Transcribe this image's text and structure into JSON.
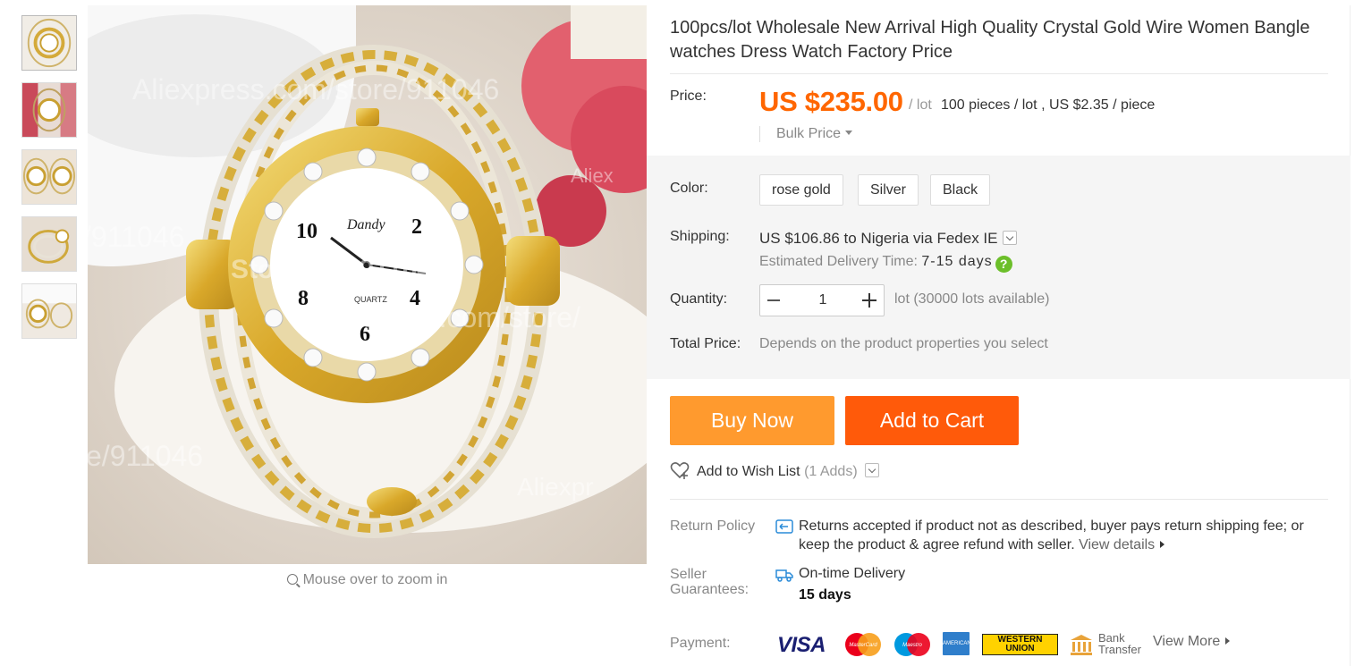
{
  "gallery": {
    "thumbnails": [
      "thumbnail-1",
      "thumbnail-2",
      "thumbnail-3",
      "thumbnail-4",
      "thumbnail-5"
    ],
    "zoom_hint": "Mouse over to zoom in",
    "watermarks": [
      "Aliexpress.com/store/911046",
      "/911046",
      "Store No: 911046",
      "Aliexpress.com/store/",
      "e/911046",
      "Aliexpr",
      "Aliex"
    ],
    "watch_dial": {
      "brand": "Dandy",
      "movement": "QUARTZ",
      "numerals": [
        "10",
        "2",
        "8",
        "4",
        "6"
      ]
    }
  },
  "product": {
    "title": "100pcs/lot Wholesale New Arrival High Quality Crystal Gold Wire Women Bangle watches Dress Watch Factory Price"
  },
  "price": {
    "label": "Price:",
    "amount": "US $235.00",
    "unit": "/ lot",
    "pieces": "100 pieces / lot , US $2.35 / piece",
    "bulk_label": "Bulk Price"
  },
  "color": {
    "label": "Color:",
    "options": [
      "rose gold",
      "Silver",
      "Black"
    ]
  },
  "shipping": {
    "label": "Shipping:",
    "main": "US $106.86 to Nigeria via Fedex IE",
    "delivery_label": "Estimated Delivery Time:",
    "delivery_days": "7-15 days",
    "help": "?"
  },
  "quantity": {
    "label": "Quantity:",
    "value": "1",
    "available": "lot (30000 lots available)"
  },
  "total": {
    "label": "Total Price:",
    "text": "Depends on the product properties you select"
  },
  "actions": {
    "buy_now": "Buy Now",
    "add_to_cart": "Add to Cart",
    "wish_list": "Add to Wish List",
    "wish_count": "(1 Adds)"
  },
  "return_policy": {
    "label": "Return Policy",
    "text": "Returns accepted if product not as described, buyer pays return shipping fee; or keep the product & agree refund with seller.",
    "link": "View details"
  },
  "seller_guarantees": {
    "label": "Seller Guarantees:",
    "delivery": "On-time Delivery",
    "days": "15 days"
  },
  "payment": {
    "label": "Payment:",
    "visa": "VISA",
    "mastercard": "MasterCard",
    "maestro": "Maestro",
    "amex": "AMERICAN EXPRESS",
    "western_union_1": "WESTERN",
    "western_union_2": "UNION",
    "bank_1": "Bank",
    "bank_2": "Transfer",
    "view_more": "View More"
  },
  "colors": {
    "accent_orange": "#ff6600",
    "buy_now": "#ff9a2e",
    "add_to_cart": "#ff5a0a",
    "help_green": "#6cbf2a"
  }
}
